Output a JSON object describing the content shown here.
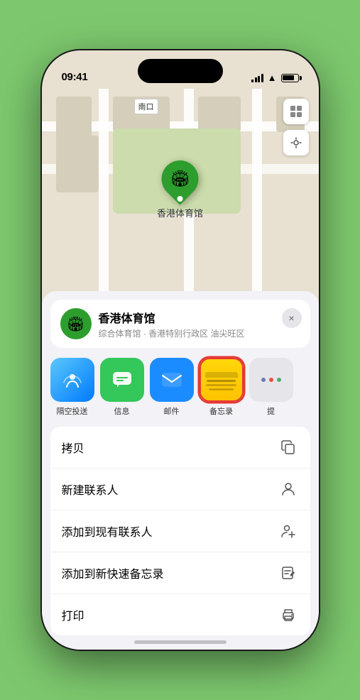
{
  "status": {
    "time": "09:41",
    "location_arrow": "▲"
  },
  "map": {
    "label": "南口",
    "stadium_name": "香港体育馆",
    "stadium_label": "香港体育馆"
  },
  "location_card": {
    "name": "香港体育馆",
    "description": "综合体育馆 · 香港特别行政区 油尖旺区",
    "close_label": "×"
  },
  "share_items": [
    {
      "id": "airdrop",
      "label": "隔空投送"
    },
    {
      "id": "messages",
      "label": "信息"
    },
    {
      "id": "mail",
      "label": "邮件"
    },
    {
      "id": "notes",
      "label": "备忘录"
    },
    {
      "id": "more",
      "label": "提"
    }
  ],
  "actions": [
    {
      "label": "拷贝",
      "icon": "copy"
    },
    {
      "label": "新建联系人",
      "icon": "person"
    },
    {
      "label": "添加到现有联系人",
      "icon": "person-add"
    },
    {
      "label": "添加到新快速备忘录",
      "icon": "note"
    },
    {
      "label": "打印",
      "icon": "print"
    }
  ]
}
